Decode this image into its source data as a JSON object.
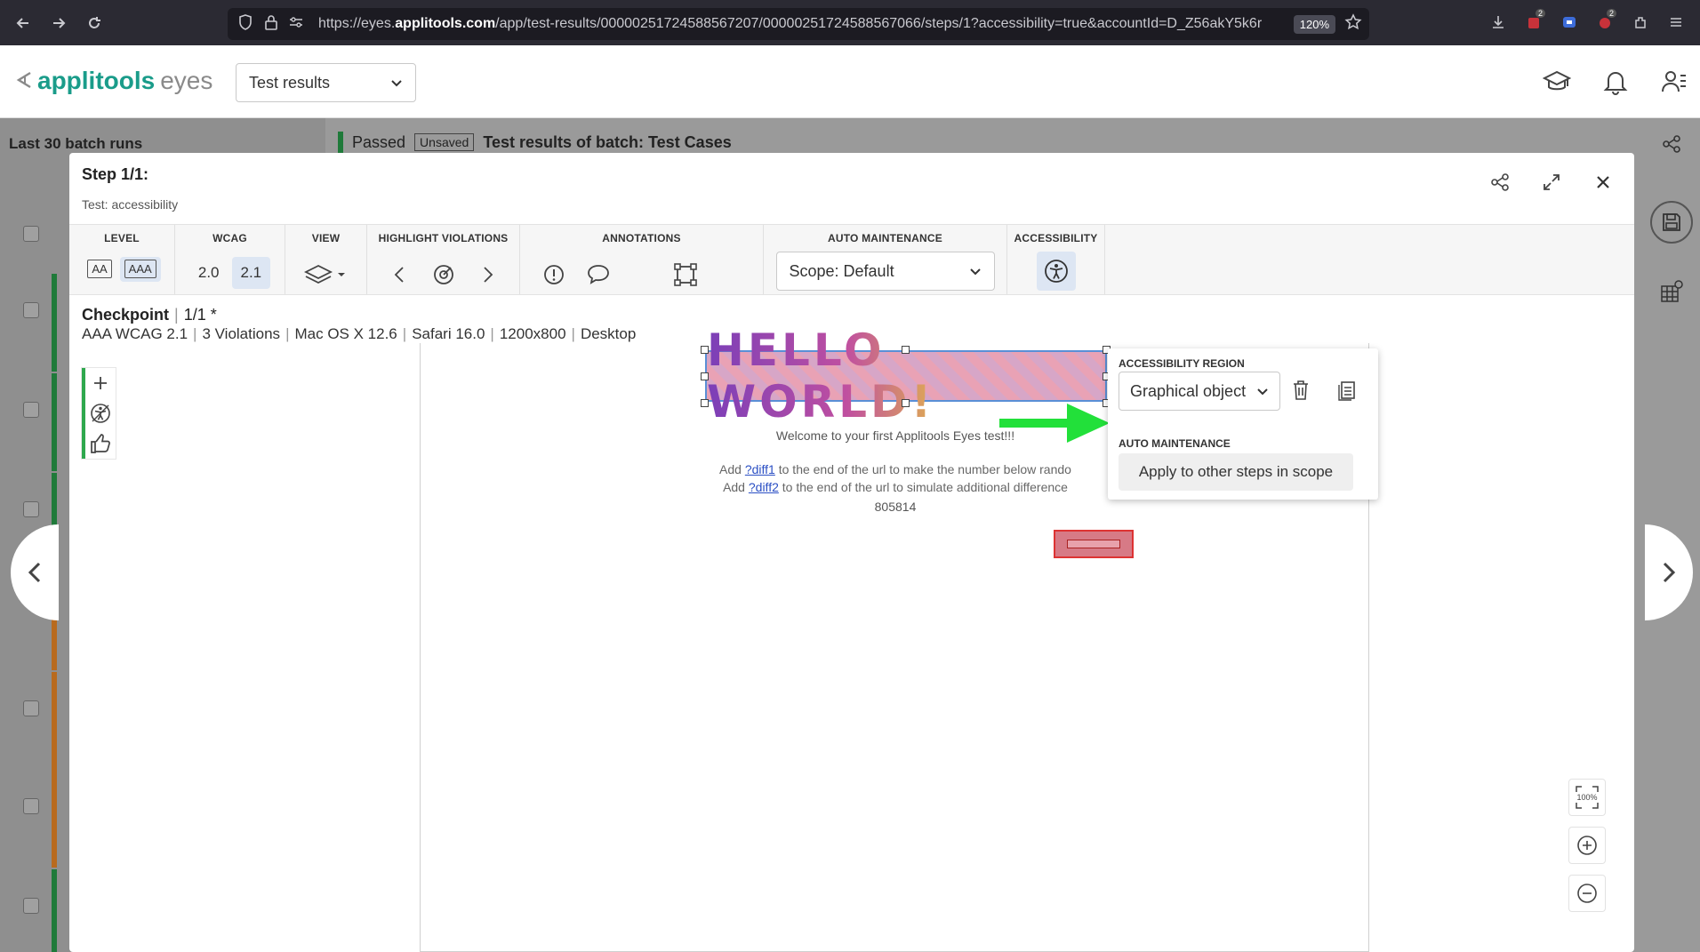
{
  "browser": {
    "url_prefix": "https://eyes.",
    "url_domain": "applitools.com",
    "url_path": "/app/test-results/00000251724588567207/00000251724588567066/steps/1?accessibility=true&accountId=D_Z56akY5k6r",
    "zoom": "120%",
    "badge_counts": [
      "2",
      "2"
    ]
  },
  "header": {
    "logo_main": "applitools",
    "logo_sub": "eyes",
    "section_select": "Test results"
  },
  "background": {
    "panel_title": "Last 30 batch runs",
    "status": "Passed",
    "unsaved": "Unsaved",
    "batch_title": "Test results of batch:  Test Cases"
  },
  "modal": {
    "step_title": "Step 1/1:",
    "test_name": "Test: accessibility",
    "toolbar": {
      "level_label": "LEVEL",
      "level_aa": "AA",
      "level_aaa": "AAA",
      "wcag_label": "WCAG",
      "wcag_20": "2.0",
      "wcag_21": "2.1",
      "view_label": "VIEW",
      "highlight_label": "HIGHLIGHT VIOLATIONS",
      "annotations_label": "ANNOTATIONS",
      "auto_maint_label": "AUTO MAINTENANCE",
      "scope_value": "Scope: Default",
      "accessibility_label": "ACCESSIBILITY"
    },
    "checkpoint": {
      "label": "Checkpoint",
      "count": "1/1",
      "star": "*",
      "standard": "AAA WCAG 2.1",
      "violations": "3 Violations",
      "os": "Mac OS X 12.6",
      "browser": "Safari 16.0",
      "viewport": "1200x800",
      "device": "Desktop"
    },
    "canvas": {
      "hello": "HELLO WORLD!",
      "welcome": "Welcome to your first Applitools Eyes test!!!",
      "line1_pre": "Add ",
      "line1_link": "?diff1",
      "line1_post": " to the end of the url to make the number below rando",
      "line2_pre": "Add ",
      "line2_link": "?diff2",
      "line2_post": " to the end of the url to simulate additional difference",
      "number": "805814"
    },
    "popup": {
      "region_label": "ACCESSIBILITY REGION",
      "region_value": "Graphical object",
      "auto_label": "AUTO MAINTENANCE",
      "apply_label": "Apply to other steps in scope"
    },
    "zoom_label": "100%"
  },
  "colors": {
    "accent_green": "#2ea84d",
    "arrow_green": "#22e03a",
    "active_blue": "#dde6f3",
    "brand": "#1a9c8a"
  }
}
